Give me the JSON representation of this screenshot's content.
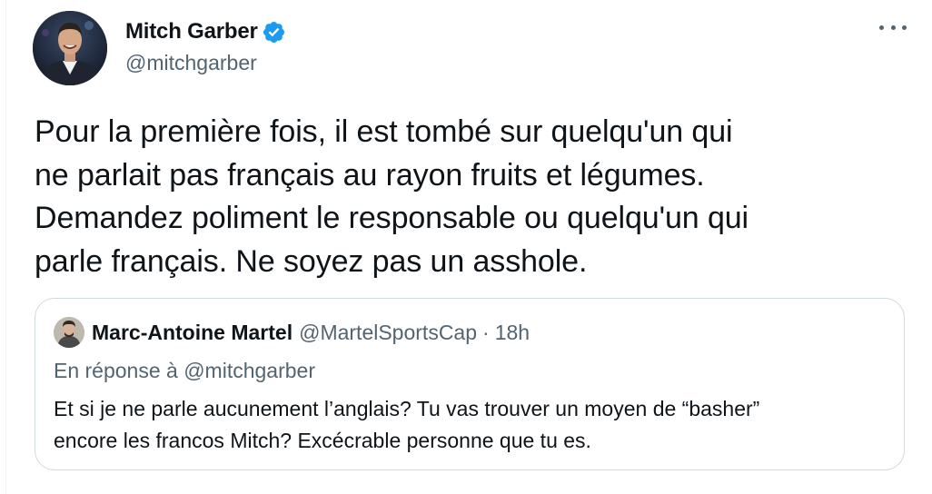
{
  "author": {
    "display_name": "Mitch Garber",
    "handle": "@mitchgarber",
    "verified_icon": "verified-badge-icon",
    "avatar": "avatar-photo"
  },
  "more_icon": "more-options-icon",
  "tweet": {
    "text": "Pour la première fois, il est tombé sur quelqu'un qui\nne parlait pas français au rayon fruits et légumes.\nDemandez poliment le responsable ou quelqu'un qui\nparle français. Ne soyez pas un asshole."
  },
  "quoted_tweet": {
    "display_name": "Marc-Antoine Martel",
    "handle": "@MartelSportsCap",
    "separator": "·",
    "time": "18h",
    "reply_to": "En réponse à @mitchgarber",
    "text": "Et si je ne parle aucunement l’anglais? Tu vas trouver un moyen de “basher”\nencore les francos Mitch? Excécrable personne que tu es."
  },
  "colors": {
    "text_primary": "#0f1419",
    "text_secondary": "#536471",
    "verified_blue": "#1d9bf0",
    "border": "#cfd9de"
  }
}
